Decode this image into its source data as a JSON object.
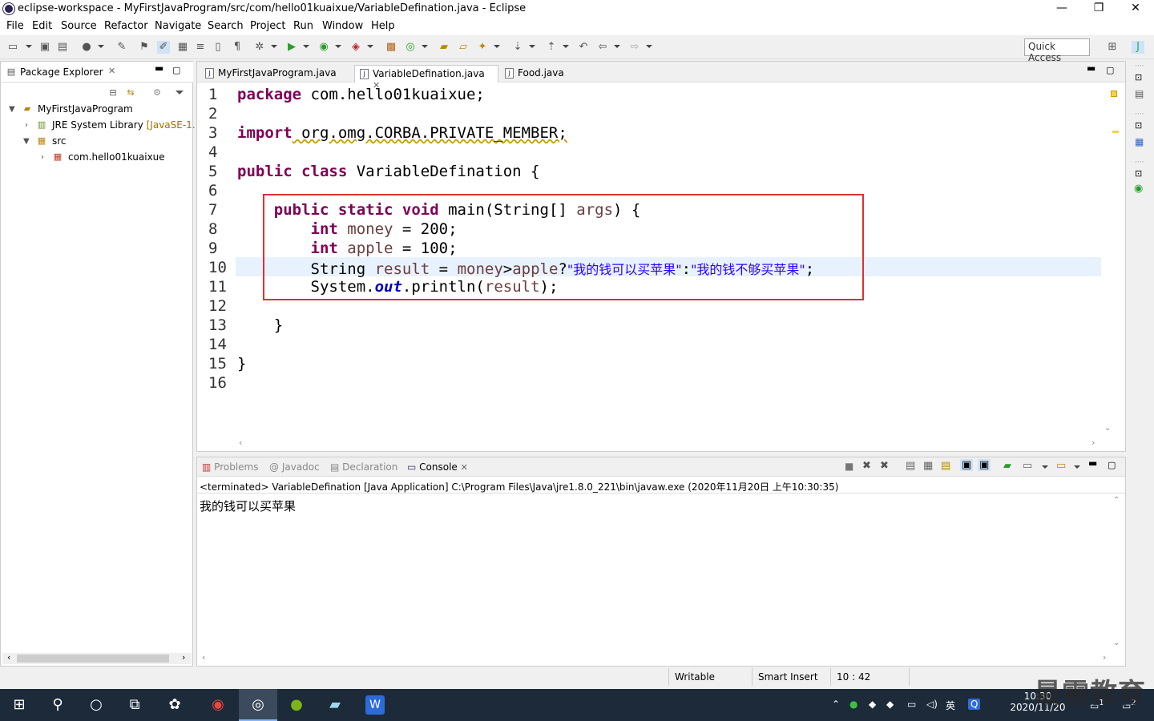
{
  "window": {
    "title": "eclipse-workspace - MyFirstJavaProgram/src/com/hello01kuaixue/VariableDefination.java - Eclipse",
    "minimize": "—",
    "restore": "❐",
    "close": "✕"
  },
  "menu": [
    "File",
    "Edit",
    "Source",
    "Refactor",
    "Navigate",
    "Search",
    "Project",
    "Run",
    "Window",
    "Help"
  ],
  "quick_access": "Quick Access",
  "package_explorer": {
    "title": "Package Explorer",
    "tree": [
      {
        "label": "MyFirstJavaProgram",
        "level": 0,
        "expanded": true
      },
      {
        "label": "JRE System Library",
        "extra": "[JavaSE-1.",
        "level": 1,
        "expanded": false
      },
      {
        "label": "src",
        "level": 1,
        "expanded": true
      },
      {
        "label": "com.hello01kuaixue",
        "level": 2,
        "expanded": false
      }
    ]
  },
  "editor": {
    "tabs": [
      {
        "label": "MyFirstJavaProgram.java",
        "active": false
      },
      {
        "label": "VariableDefination.java",
        "active": true
      },
      {
        "label": "Food.java",
        "active": false
      }
    ],
    "line_numbers": [
      "1",
      "2",
      "3",
      "4",
      "5",
      "6",
      "7",
      "8",
      "9",
      "10",
      "11",
      "12",
      "13",
      "14",
      "15",
      "16"
    ],
    "code": {
      "l1_kw": "package",
      "l1_rest": " com.hello01kuaixue;",
      "l3_kw": "import",
      "l3_rest": " org.omg.CORBA.PRIVATE_MEMBER;",
      "l5_kw": "public class",
      "l5_rest": " VariableDefination {",
      "l7_indent": "    ",
      "l7_kw": "public static void",
      "l7_rest": " main(String[] ",
      "l7_var": "args",
      "l7_end": ") {",
      "l8_indent": "        ",
      "l8_kw": "int",
      "l8_var": " money",
      "l8_rest": " = 200;",
      "l9_indent": "        ",
      "l9_kw": "int",
      "l9_var": " apple",
      "l9_rest": " = 100;",
      "l10_a": "        String ",
      "l10_var1": "result",
      "l10_b": " = ",
      "l10_var2": "money",
      "l10_c": ">",
      "l10_var3": "apple",
      "l10_d": "?",
      "l10_s1": "\"我的钱可以买苹果\"",
      "l10_e": ":",
      "l10_s2": "\"我的钱不够买苹果\"",
      "l10_f": ";",
      "l11_a": "        System.",
      "l11_fld": "out",
      "l11_b": ".println(",
      "l11_var": "result",
      "l11_c": ");",
      "l13": "    }",
      "l15": "}"
    }
  },
  "console": {
    "tabs": [
      {
        "label": "Problems",
        "active": false
      },
      {
        "label": "Javadoc",
        "active": false
      },
      {
        "label": "Declaration",
        "active": false
      },
      {
        "label": "Console",
        "active": true
      }
    ],
    "header": "<terminated> VariableDefination [Java Application] C:\\Program Files\\Java\\jre1.8.0_221\\bin\\javaw.exe (2020年11月20日 上午10:30:35)",
    "output": "我的钱可以买苹果"
  },
  "status": {
    "writable": "Writable",
    "insert_mode": "Smart Insert",
    "position": "10 : 42"
  },
  "taskbar": {
    "time": "10:30",
    "date": "2020/11/20",
    "ime": "英",
    "notifications": "2",
    "desktop_badge": "1"
  },
  "watermark": "最需教育"
}
